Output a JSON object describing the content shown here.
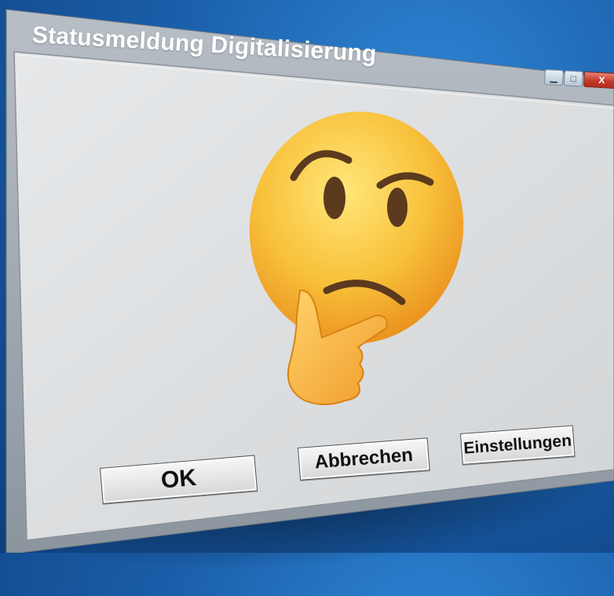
{
  "window": {
    "title": "Statusmeldung Digitalisierung",
    "controls": {
      "minimize_icon": "minimize-icon",
      "maximize_icon": "maximize-icon",
      "close_label": "X"
    }
  },
  "dialog": {
    "icon": "thinking-face-emoji",
    "buttons": {
      "ok_label": "OK",
      "cancel_label": "Abbrechen",
      "settings_label": "Einstellungen"
    }
  },
  "colors": {
    "desktop_blue": "#1a5ea9",
    "window_gray": "#d9dbdc",
    "titlebar_gray": "#9aa4ad",
    "close_red": "#c43c2b",
    "emoji_yellow": "#f6b62f"
  }
}
